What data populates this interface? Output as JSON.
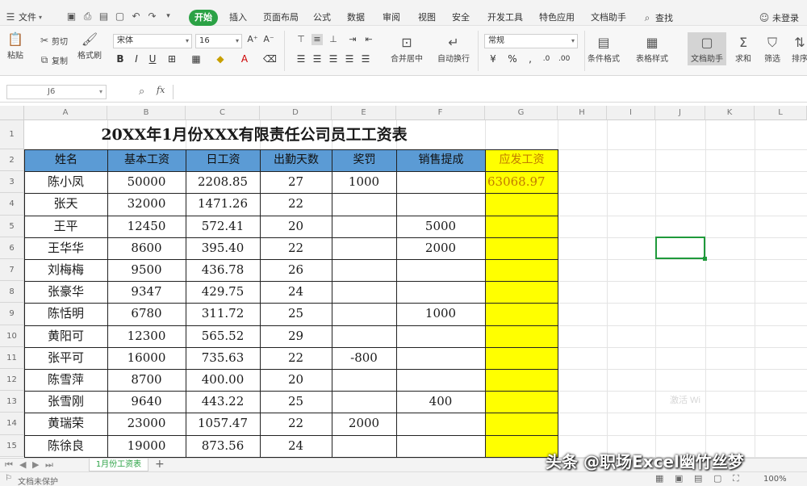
{
  "menubar": {
    "file_menu": "文件",
    "tabs": [
      "开始",
      "插入",
      "页面布局",
      "公式",
      "数据",
      "审阅",
      "视图",
      "安全",
      "开发工具",
      "特色应用",
      "文档助手"
    ],
    "active_tab": "开始",
    "search_label": "查找",
    "user_label": "未登录"
  },
  "ribbon": {
    "format_painter_row1": "格式刷",
    "paste_label": "粘贴",
    "cut_label": "剪切",
    "copy_label": "复制",
    "format_painter_label": "格式刷",
    "font_name": "宋体",
    "font_size": "16",
    "merge_center_label": "合并居中",
    "wrap_text_label": "自动换行",
    "number_format": "常规",
    "conditional_format_label": "条件格式",
    "table_style_label": "表格样式",
    "cell_style_label": "文档助手",
    "sum_label": "求和",
    "filter_label": "筛选",
    "sort_label": "排序"
  },
  "formula_bar": {
    "cell_ref": "J6",
    "fx_label": "fx",
    "content": ""
  },
  "columns": [
    "A",
    "B",
    "C",
    "D",
    "E",
    "F",
    "G",
    "H",
    "I",
    "J",
    "K",
    "L"
  ],
  "rows": [
    "1",
    "2",
    "3",
    "4",
    "5",
    "6",
    "7",
    "8",
    "9",
    "10",
    "11",
    "12",
    "13",
    "14",
    "15"
  ],
  "sheet": {
    "title": "20XX年1月份XXX有限责任公司员工工资表",
    "headers": [
      "姓名",
      "基本工资",
      "日工资",
      "出勤天数",
      "奖罚",
      "销售提成",
      "应发工资"
    ],
    "data": [
      [
        "陈小凤",
        "50000",
        "2208.85",
        "27",
        "1000",
        "",
        "63068.97"
      ],
      [
        "张天",
        "32000",
        "1471.26",
        "22",
        "",
        "",
        ""
      ],
      [
        "王平",
        "12450",
        "572.41",
        "20",
        "",
        "5000",
        ""
      ],
      [
        "王华华",
        "8600",
        "395.40",
        "22",
        "",
        "2000",
        ""
      ],
      [
        "刘梅梅",
        "9500",
        "436.78",
        "26",
        "",
        "",
        ""
      ],
      [
        "张豪华",
        "9347",
        "429.75",
        "24",
        "",
        "",
        ""
      ],
      [
        "陈恬明",
        "6780",
        "311.72",
        "25",
        "",
        "1000",
        ""
      ],
      [
        "黄阳可",
        "12300",
        "565.52",
        "29",
        "",
        "",
        ""
      ],
      [
        "张平可",
        "16000",
        "735.63",
        "22",
        "-800",
        "",
        ""
      ],
      [
        "陈雪萍",
        "8700",
        "400.00",
        "20",
        "",
        "",
        ""
      ],
      [
        "张雪刚",
        "9640",
        "443.22",
        "25",
        "",
        "400",
        ""
      ],
      [
        "黄瑞荣",
        "23000",
        "1057.47",
        "22",
        "2000",
        "",
        ""
      ],
      [
        "陈徐良",
        "19000",
        "873.56",
        "24",
        "",
        "",
        ""
      ]
    ]
  },
  "sheet_tabs": {
    "active": "1月份工资表",
    "add": "+"
  },
  "status": {
    "left": "文档未保护",
    "zoom": "100%"
  },
  "overlays": {
    "watermark_caption": "头条 @职场Excel幽竹丝梦",
    "activate_hint": "激活 Wi"
  },
  "colors": {
    "accent_green": "#2ba245",
    "header_blue": "#5b9bd5",
    "highlight_yellow": "#ffff00"
  }
}
